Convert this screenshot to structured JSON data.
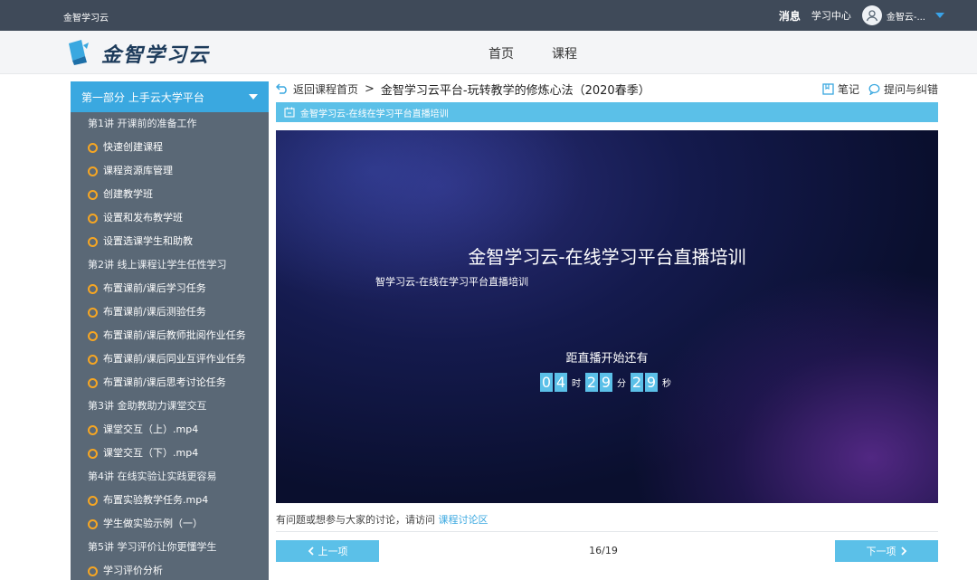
{
  "topbar": {
    "site_name": "金智学习云",
    "messages": "消息",
    "learning_center": "学习中心",
    "user_name": "金智云-..."
  },
  "header": {
    "logo_text": "金智学习云",
    "nav": [
      "首页",
      "课程"
    ]
  },
  "sidebar": {
    "section_title": "第一部分 上手云大学平台",
    "items": [
      {
        "type": "chapter",
        "label": "第1讲 开课前的准备工作"
      },
      {
        "type": "item",
        "label": "快速创建课程"
      },
      {
        "type": "item",
        "label": "课程资源库管理"
      },
      {
        "type": "item",
        "label": "创建教学班"
      },
      {
        "type": "item",
        "label": "设置和发布教学班"
      },
      {
        "type": "item",
        "label": "设置选课学生和助教"
      },
      {
        "type": "chapter",
        "label": "第2讲 线上课程让学生任性学习"
      },
      {
        "type": "item",
        "label": "布置课前/课后学习任务"
      },
      {
        "type": "item",
        "label": "布置课前/课后测验任务"
      },
      {
        "type": "item",
        "label": "布置课前/课后教师批阅作业任务"
      },
      {
        "type": "item",
        "label": "布置课前/课后同业互评作业任务"
      },
      {
        "type": "item",
        "label": "布置课前/课后思考讨论任务"
      },
      {
        "type": "chapter",
        "label": "第3讲 金助教助力课堂交互"
      },
      {
        "type": "item",
        "label": "课堂交互（上）.mp4"
      },
      {
        "type": "item",
        "label": "课堂交互（下）.mp4"
      },
      {
        "type": "chapter",
        "label": "第4讲 在线实验让实践更容易"
      },
      {
        "type": "item",
        "label": "布置实验教学任务.mp4"
      },
      {
        "type": "item",
        "label": "学生做实验示例（一）"
      },
      {
        "type": "chapter",
        "label": "第5讲 学习评价让你更懂学生"
      },
      {
        "type": "item",
        "label": "学习评价分析"
      }
    ]
  },
  "breadcrumb": {
    "back_label": "返回课程首页",
    "separator": ">",
    "course_title": "金智学习云平台-玩转教学的修炼心法（2020春季）",
    "notes": "笔记",
    "ask": "提问与纠错"
  },
  "lesson": {
    "title": "金智学习云-在线在学习平台直播培训"
  },
  "video": {
    "title": "金智学习云-在线学习平台直播培训",
    "subtitle": "智学习云-在线在学习平台直播培训",
    "countdown_label": "距直播开始还有",
    "hours": [
      "0",
      "4"
    ],
    "minutes": [
      "2",
      "9"
    ],
    "seconds": [
      "2",
      "9"
    ],
    "unit_hour": "时",
    "unit_minute": "分",
    "unit_second": "秒"
  },
  "footer": {
    "discuss_text": "有问题或想参与大家的讨论，请访问",
    "discuss_link": "课程讨论区",
    "prev": "上一项",
    "next": "下一项",
    "pager": "16/19"
  },
  "colors": {
    "accent": "#5bc0e8",
    "topbar": "#3f4a59",
    "sidebar": "#5a6876",
    "ring": "#f6a623"
  }
}
